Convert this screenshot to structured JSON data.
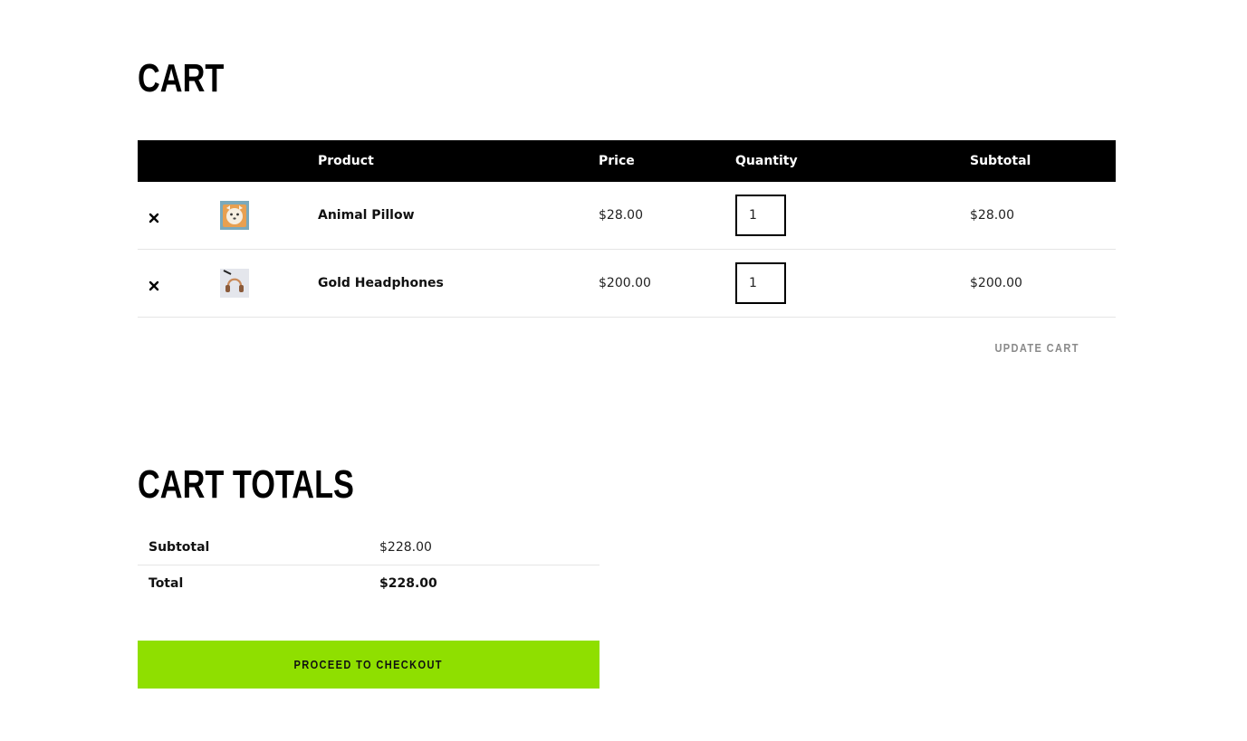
{
  "cart": {
    "title": "Cart",
    "columns": {
      "product": "Product",
      "price": "Price",
      "quantity": "Quantity",
      "subtotal": "Subtotal"
    },
    "items": [
      {
        "name": "Animal Pillow",
        "price": "$28.00",
        "quantity": "1",
        "subtotal": "$28.00",
        "remove_icon": "close-icon",
        "thumbnail": "animal-pillow-thumbnail"
      },
      {
        "name": "Gold Headphones",
        "price": "$200.00",
        "quantity": "1",
        "subtotal": "$200.00",
        "remove_icon": "close-icon",
        "thumbnail": "gold-headphones-thumbnail"
      }
    ],
    "update_label": "Update cart"
  },
  "totals": {
    "title": "Cart totals",
    "subtotal_label": "Subtotal",
    "subtotal_value": "$228.00",
    "total_label": "Total",
    "total_value": "$228.00"
  },
  "checkout": {
    "label": "Proceed to checkout"
  },
  "colors": {
    "header_bg": "#000000",
    "checkout_bg": "#8fdf00",
    "update_text": "#8a8a8a"
  }
}
